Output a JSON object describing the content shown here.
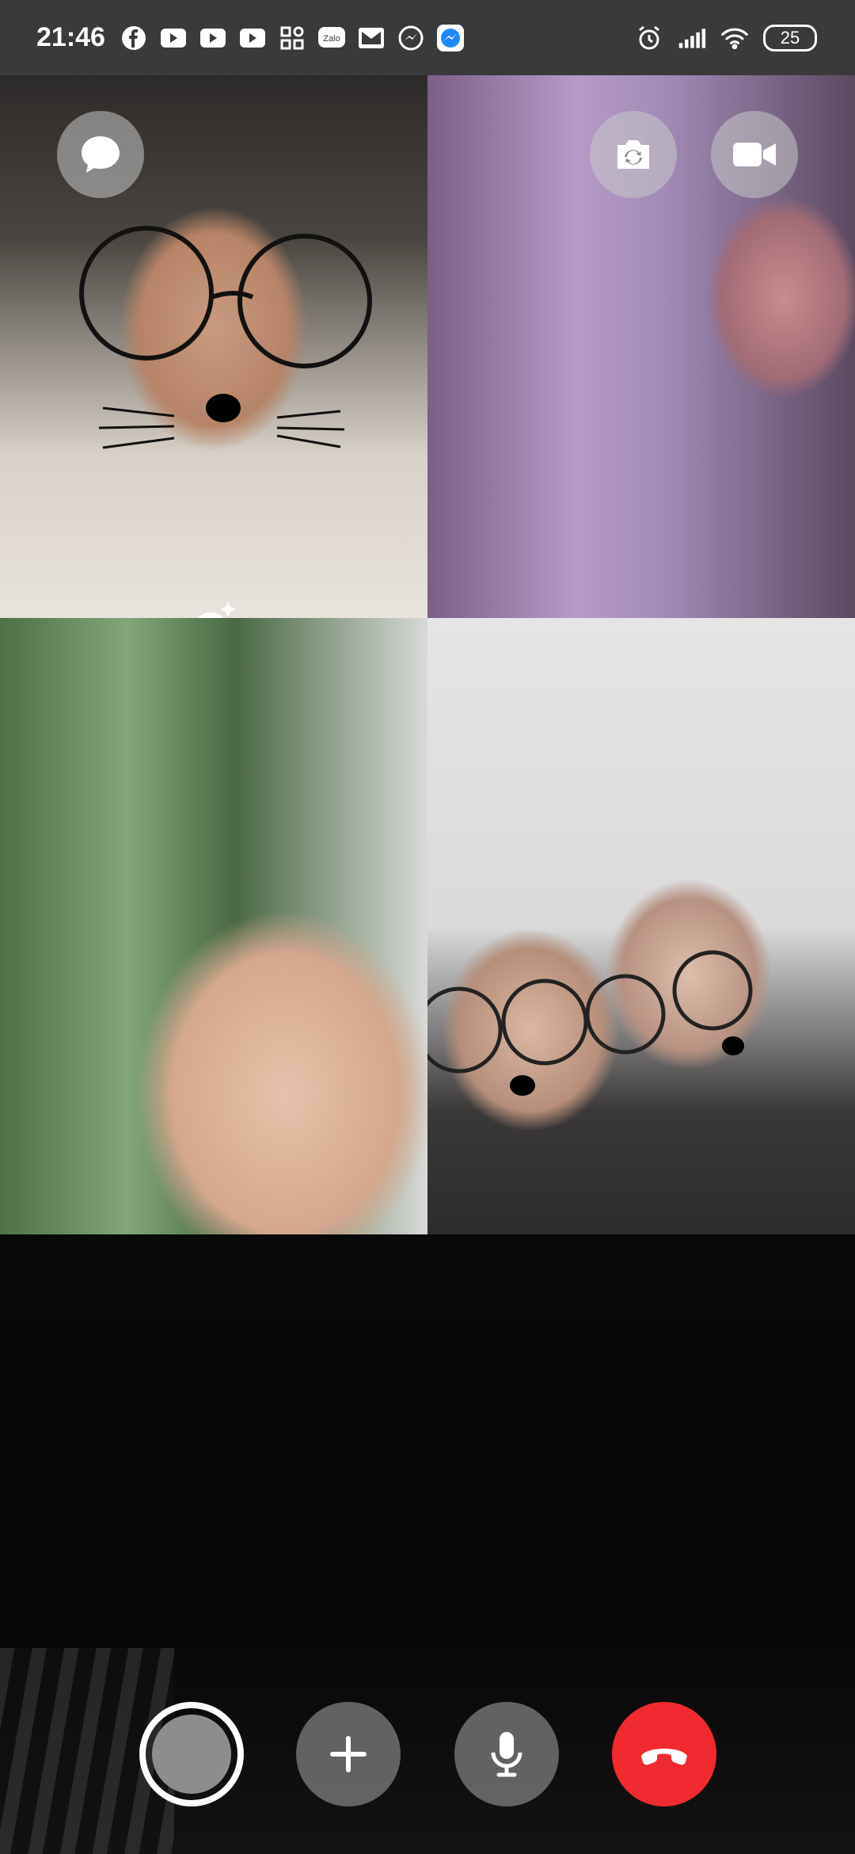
{
  "status_bar": {
    "time": "21:46",
    "icons": [
      "facebook-icon",
      "youtube-icon",
      "youtube-icon",
      "youtube-icon",
      "apps-icon",
      "zalo-icon",
      "gmail-icon",
      "messenger-icon",
      "messenger-icon"
    ],
    "zalo_label": "Zalo",
    "battery": "25"
  },
  "participants": [
    {
      "name": "",
      "has_filter": true
    },
    {
      "name": "",
      "has_filter": false
    },
    {
      "name": "",
      "has_filter": false
    },
    {
      "name": "",
      "has_filter": true
    }
  ],
  "controls": [
    "chat-icon",
    "flip-camera-icon",
    "video-camera-icon",
    "capture-icon",
    "add-person-icon",
    "microphone-icon",
    "end-call-icon"
  ],
  "colors": {
    "end_call": "#f02a2e",
    "status_bar": "#3a3a3a"
  }
}
